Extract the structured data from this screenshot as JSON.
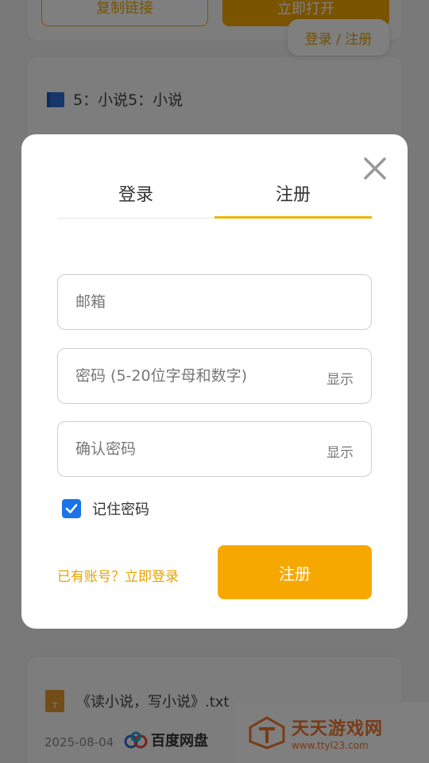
{
  "background": {
    "top_card": {
      "copy_button": "复制链接",
      "open_button": "立即打开"
    },
    "float_login": "登录 / 注册",
    "card2": {
      "title": "5：小说5：小说"
    },
    "card3": {
      "file_icon_letter": "T",
      "title": "《读小说，写小说》.txt",
      "date": "2025-08-04",
      "source": "百度网盘"
    },
    "watermark": {
      "title": "天天游戏网",
      "url": "www.ttyl23.com"
    }
  },
  "modal": {
    "tabs": [
      {
        "label": "登录",
        "active": false
      },
      {
        "label": "注册",
        "active": true
      }
    ],
    "fields": {
      "email": {
        "placeholder": "邮箱",
        "value": ""
      },
      "password": {
        "placeholder": "密码 (5-20位字母和数字)",
        "value": "",
        "toggle": "显示"
      },
      "confirm": {
        "placeholder": "确认密码",
        "value": "",
        "toggle": "显示"
      }
    },
    "remember": {
      "label": "记住密码",
      "checked": true
    },
    "login_link": "已有账号？立即登录",
    "submit": "注册"
  },
  "colors": {
    "accent": "#f7a800",
    "accent_text": "#e6a200",
    "checkbox": "#1a73e8"
  },
  "icons": [
    "close-icon",
    "folder-icon",
    "txt-file-icon",
    "baidu-cloud-icon",
    "check-icon",
    "watermark-logo-icon"
  ]
}
